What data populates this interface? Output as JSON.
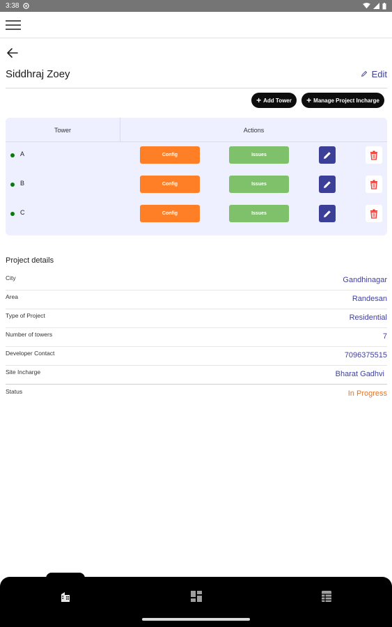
{
  "status_bar": {
    "time": "3:38"
  },
  "header": {
    "title": "Siddhraj Zoey",
    "edit_label": "Edit"
  },
  "toolbar": {
    "add_tower_label": "Add Tower",
    "manage_incharge_label": "Manage Project Incharge"
  },
  "towers_table": {
    "col_tower": "Tower",
    "col_actions": "Actions",
    "config_label": "Config",
    "issues_label": "Issues",
    "rows": [
      {
        "name": "A"
      },
      {
        "name": "B"
      },
      {
        "name": "C"
      }
    ]
  },
  "project_details": {
    "title": "Project details",
    "rows": [
      {
        "label": "City",
        "value": "Gandhinagar"
      },
      {
        "label": "Area",
        "value": "Randesan"
      },
      {
        "label": "Type of Project",
        "value": "Residential"
      },
      {
        "label": "Number of towers",
        "value": "7"
      },
      {
        "label": "Developer Contact",
        "value": "7096375515"
      },
      {
        "label": "Site Incharge",
        "value": "Bharat Gadhvi"
      },
      {
        "label": "Status",
        "value": "In Progress"
      }
    ]
  },
  "colors": {
    "accent": "#3f3f9f",
    "config": "#ff7f27",
    "issues": "#7fc06a",
    "status_in_progress": "#e2762a",
    "active_dot": "#0a7a0a",
    "delete": "#e53935"
  },
  "bottom_nav": {
    "items": [
      "building-icon",
      "dashboard-icon",
      "table-icon"
    ],
    "active": "building-icon"
  }
}
